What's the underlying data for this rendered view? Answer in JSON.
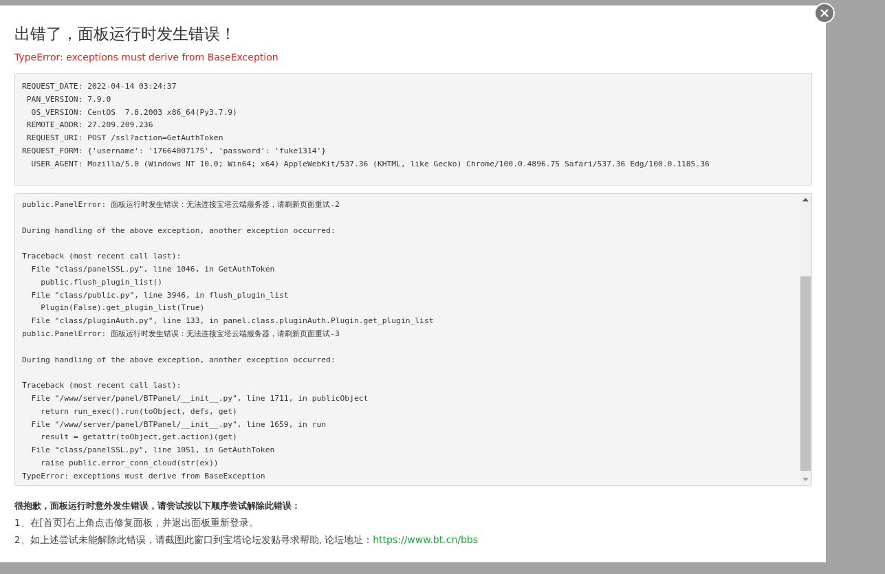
{
  "dialog": {
    "title": "出错了，面板运行时发生错误！",
    "error": "TypeError: exceptions must derive from BaseException",
    "request_info": [
      "REQUEST_DATE: 2022-04-14 03:24:37",
      " PAN_VERSION: 7.9.0",
      "  OS_VERSION: CentOS  7.8.2003 x86_64(Py3.7.9)",
      " REMOTE_ADDR: 27.209.209.236",
      " REQUEST_URI: POST /ssl?action=GetAuthToken",
      "REQUEST_FORM: {'username': '17664007175', 'password': 'fuke1314'}",
      "  USER_AGENT: Mozilla/5.0 (Windows NT 10.0; Win64; x64) AppleWebKit/537.36 (KHTML, like Gecko) Chrome/100.0.4896.75 Safari/537.36 Edg/100.0.1185.36"
    ],
    "traceback_blocks": [
      [
        "public.PanelError: 面板运行时发生错误：无法连接宝塔云端服务器，请刷新页面重试-2"
      ],
      [
        "During handling of the above exception, another exception occurred:"
      ],
      [
        "Traceback (most recent call last):",
        "  File \"class/panelSSL.py\", line 1046, in GetAuthToken",
        "    public.flush_plugin_list()",
        "  File \"class/public.py\", line 3946, in flush_plugin_list",
        "    Plugin(False).get_plugin_list(True)",
        "  File \"class/pluginAuth.py\", line 133, in panel.class.pluginAuth.Plugin.get_plugin_list",
        "public.PanelError: 面板运行时发生错误：无法连接宝塔云端服务器，请刷新页面重试-3"
      ],
      [
        "During handling of the above exception, another exception occurred:"
      ],
      [
        "Traceback (most recent call last):",
        "  File \"/www/server/panel/BTPanel/__init__.py\", line 1711, in publicObject",
        "    return run_exec().run(toObject, defs, get)",
        "  File \"/www/server/panel/BTPanel/__init__.py\", line 1659, in run",
        "    result = getattr(toObject,get.action)(get)",
        "  File \"class/panelSSL.py\", line 1051, in GetAuthToken",
        "    raise public.error_conn_cloud(str(ex))",
        "TypeError: exceptions must derive from BaseException"
      ]
    ],
    "help_heading": "很抱歉，面板运行时意外发生错误，请尝试按以下顺序尝试解除此错误：",
    "help_steps": [
      {
        "text": "1、在[首页]右上角点击修复面板，并退出面板重新登录。"
      },
      {
        "text": "2、如上述尝试未能解除此错误，请截图此窗口到宝塔论坛发贴寻求帮助, 论坛地址：",
        "link": "https://www.bt.cn/bbs"
      }
    ]
  }
}
